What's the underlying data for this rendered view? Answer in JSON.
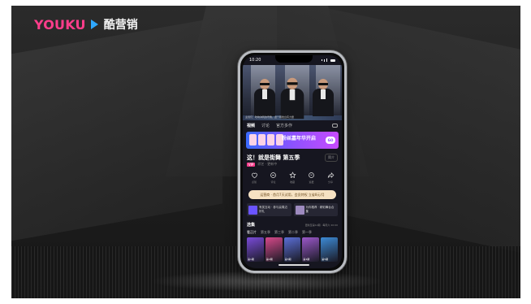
{
  "brand": {
    "logo_word": "YOUKU",
    "logo_cn": "酷营销",
    "colors": {
      "youku_pink": "#ff3d8b",
      "youku_blue": "#2fa8ff"
    }
  },
  "phone": {
    "status": {
      "time": "10:20"
    },
    "video": {
      "caption": "主创们：吹响冲刺的号角，这一场舞台有力量"
    },
    "tabs": [
      "视频",
      "讨论",
      "官方多作"
    ],
    "banner": {
      "text": "粉丝嘉年华开启",
      "button": "GO"
    },
    "show": {
      "title": "这！就是街舞 第五季",
      "intro_label": "简介",
      "tag_vip": "VIP",
      "meta": "综艺 · 更新中"
    },
    "actions": [
      {
        "icon": "heart-icon",
        "label": "点赞"
      },
      {
        "icon": "comment-icon",
        "label": "评论"
      },
      {
        "icon": "star-icon",
        "label": "收藏"
      },
      {
        "icon": "bell-icon",
        "label": "追更"
      },
      {
        "icon": "share-icon",
        "label": "分享"
      }
    ],
    "notice": "运营商 · 首月7天试用，会员特权 立省8元/月",
    "promos": [
      {
        "text": "有奖互动 · 参与赢周边好礼"
      },
      {
        "text": "为你推荐 · 精彩舞台合集"
      }
    ],
    "episodes": {
      "title": "选集",
      "subtitle": "更新至第12期 · 每周六 20:00",
      "tabs": [
        "看正片",
        "第五季",
        "第三季",
        "第二季",
        "第一季"
      ],
      "thumbs": [
        {
          "label": "第1期",
          "color": "#7a4bd8"
        },
        {
          "label": "第2期",
          "color": "#d6498a"
        },
        {
          "label": "第3期",
          "color": "#5b6fd6"
        },
        {
          "label": "第4期",
          "color": "#9b58c9"
        },
        {
          "label": "第5期",
          "color": "#3d8bd6"
        }
      ]
    }
  }
}
